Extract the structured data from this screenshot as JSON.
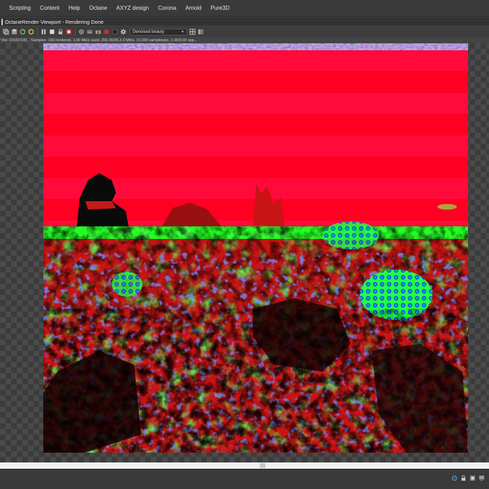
{
  "menubar": {
    "items": [
      "Scripting",
      "Content",
      "Help",
      "Octane",
      "AXYZ design",
      "Corona",
      "Arnold",
      "Pure3D"
    ]
  },
  "window": {
    "title": "OctaneRender Viewport - Rendering Done"
  },
  "toolbar": {
    "render_pass": "Denoised beauty"
  },
  "status": {
    "text": "Vbx: 0/100/100... Samples: 100 rendered, 1,00 Mb/s used, 200.00/35.3.2 Mb/s, 10,000 samples/px, 1.00/0.00 spp..."
  },
  "colors": {
    "sky": "#ff0a3a",
    "sky_band": "#ff0022",
    "ground_green": "#22ff22",
    "ground_red": "#c81414"
  }
}
